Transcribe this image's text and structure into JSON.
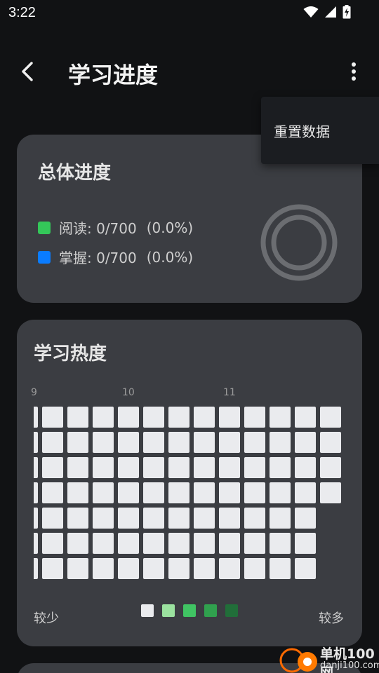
{
  "status": {
    "time": "3:22"
  },
  "header": {
    "title": "学习进度"
  },
  "menu": {
    "items": [
      {
        "label": "重置数据"
      }
    ]
  },
  "overall": {
    "title": "总体进度",
    "rows": [
      {
        "label": "阅读: 0/700",
        "percent": "(0.0%)",
        "color": "#34c759"
      },
      {
        "label": "掌握: 0/700",
        "percent": "(0.0%)",
        "color": "#0a7cff"
      }
    ],
    "ring_progress": 0.0
  },
  "heatmap": {
    "title": "学习热度",
    "months": [
      "9",
      "10",
      "11"
    ],
    "less_label": "较少",
    "more_label": "较多",
    "scale_colors": [
      "#eaebee",
      "#9be29f",
      "#40c463",
      "#30a14e",
      "#216e39"
    ],
    "cell_color": "#eaebee"
  },
  "watermark": {
    "name": "单机100网",
    "url": "danji100.com"
  },
  "colors": {
    "background": "#111214",
    "card": "#3b3d42",
    "menu": "#1b1d21"
  }
}
